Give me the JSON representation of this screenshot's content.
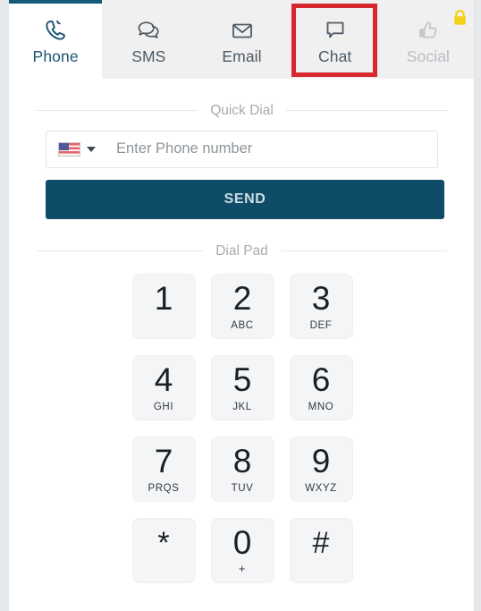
{
  "tabs": [
    {
      "label": "Phone",
      "icon": "phone-handset-icon",
      "state": "active"
    },
    {
      "label": "SMS",
      "icon": "speech-bubbles-icon",
      "state": "normal"
    },
    {
      "label": "Email",
      "icon": "envelope-icon",
      "state": "normal"
    },
    {
      "label": "Chat",
      "icon": "chat-bubble-icon",
      "state": "normal"
    },
    {
      "label": "Social",
      "icon": "thumbs-up-icon",
      "state": "disabled",
      "lock_icon": "lock-icon"
    }
  ],
  "annotation": {
    "target": "Chat",
    "color": "#d6282f"
  },
  "quick_dial": {
    "section_label": "Quick Dial",
    "country_flag": "us-flag-icon",
    "dropdown_icon": "chevron-down-icon",
    "input_value": "",
    "input_placeholder": "Enter Phone number",
    "send_label": "SEND",
    "send_color": "#0f4c68"
  },
  "dial_pad": {
    "section_label": "Dial Pad",
    "keys": [
      {
        "digit": "1",
        "letters": ""
      },
      {
        "digit": "2",
        "letters": "ABC"
      },
      {
        "digit": "3",
        "letters": "DEF"
      },
      {
        "digit": "4",
        "letters": "GHI"
      },
      {
        "digit": "5",
        "letters": "JKL"
      },
      {
        "digit": "6",
        "letters": "MNO"
      },
      {
        "digit": "7",
        "letters": "PRQS"
      },
      {
        "digit": "8",
        "letters": "TUV"
      },
      {
        "digit": "9",
        "letters": "WXYZ"
      },
      {
        "digit": "*",
        "letters": ""
      },
      {
        "digit": "0",
        "letters": "+"
      },
      {
        "digit": "#",
        "letters": ""
      }
    ]
  }
}
